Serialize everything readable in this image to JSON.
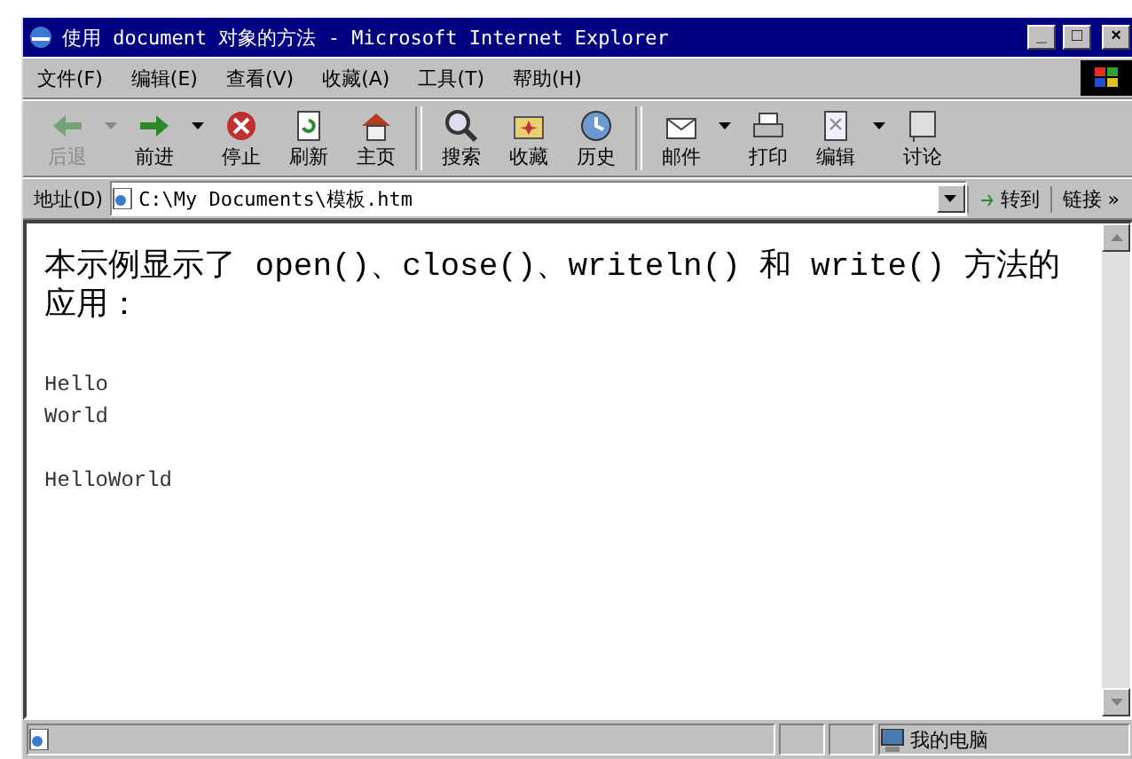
{
  "window": {
    "title": "使用 document 对象的方法 - Microsoft Internet Explorer",
    "controls": [
      "_",
      "□",
      "×"
    ]
  },
  "menu": [
    {
      "label": "文件(F)"
    },
    {
      "label": "编辑(E)"
    },
    {
      "label": "查看(V)"
    },
    {
      "label": "收藏(A)"
    },
    {
      "label": "工具(T)"
    },
    {
      "label": "帮助(H)"
    }
  ],
  "toolbar": {
    "groups": [
      [
        {
          "label": "后退",
          "disabled": true,
          "dropdown": true
        },
        {
          "label": "前进",
          "disabled": false,
          "dropdown": true
        },
        {
          "label": "停止",
          "disabled": false,
          "dropdown": false
        },
        {
          "label": "刷新",
          "disabled": false,
          "dropdown": false
        },
        {
          "label": "主页",
          "disabled": false,
          "dropdown": false
        }
      ],
      [
        {
          "label": "搜索",
          "disabled": false,
          "dropdown": false
        },
        {
          "label": "收藏",
          "disabled": false,
          "dropdown": false
        },
        {
          "label": "历史",
          "disabled": false,
          "dropdown": false
        }
      ],
      [
        {
          "label": "邮件",
          "disabled": false,
          "dropdown": true
        },
        {
          "label": "打印",
          "disabled": false,
          "dropdown": false
        },
        {
          "label": "编辑",
          "disabled": false,
          "dropdown": true
        },
        {
          "label": "讨论",
          "disabled": false,
          "dropdown": false
        }
      ]
    ]
  },
  "address": {
    "label": "地址(D)",
    "value": "C:\\My Documents\\模板.htm",
    "go": "转到",
    "links": "链接 »"
  },
  "content": {
    "heading": "本示例显示了 open()、close()、writeln() 和 write() 方法的应用：",
    "blocks": [
      [
        "Hello",
        "World"
      ],
      [
        "HelloWorld"
      ]
    ]
  },
  "status_bar": {
    "zone": "我的电脑"
  }
}
